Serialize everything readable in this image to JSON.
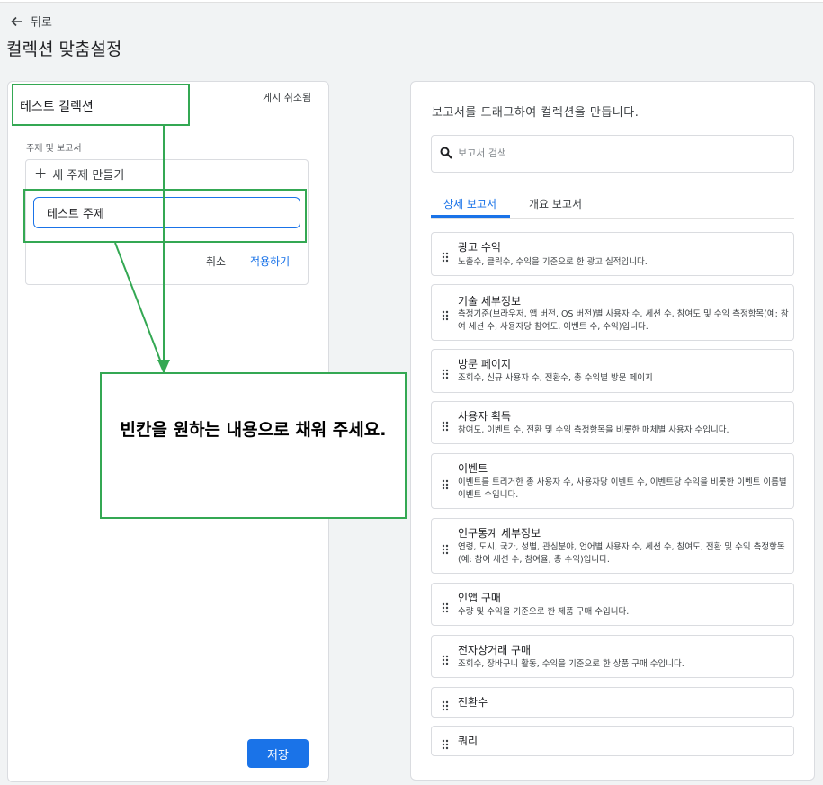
{
  "nav": {
    "back_label": "뒤로"
  },
  "page": {
    "title": "컬렉션 맞춤설정"
  },
  "collection": {
    "name": "테스트 컬렉션",
    "actions_label": "게시 취소됨",
    "section_label": "주제 및 보고서",
    "new_topic_label": "새 주제 만들기",
    "topic_value": "테스트 주제",
    "cancel_label": "취소",
    "apply_label": "적용하기",
    "save_label": "저장"
  },
  "library": {
    "heading": "보고서를 드래그하여 컬렉션을 만듭니다.",
    "search_placeholder": "보고서 검색",
    "tabs": [
      {
        "label": "상세 보고서",
        "active": true
      },
      {
        "label": "개요 보고서",
        "active": false
      }
    ],
    "cards": [
      {
        "title": "광고 수익",
        "desc": "노출수, 클릭수, 수익을 기준으로 한 광고 실적입니다."
      },
      {
        "title": "기술 세부정보",
        "desc": "측정기준(브라우저, 앱 버전, OS 버전)별 사용자 수, 세션 수, 참여도 및 수익 측정항목(예: 참여 세션 수, 사용자당 참여도, 이벤트 수, 수익)입니다."
      },
      {
        "title": "방문 페이지",
        "desc": "조회수, 신규 사용자 수, 전환수, 총 수익별 방문 페이지"
      },
      {
        "title": "사용자 획득",
        "desc": "참여도, 이벤트 수, 전환 및 수익 측정항목을 비롯한 매체별 사용자 수입니다."
      },
      {
        "title": "이벤트",
        "desc": "이벤트를 트리거한 총 사용자 수, 사용자당 이벤트 수, 이벤트당 수익을 비롯한 이벤트 이름별 이벤트 수입니다."
      },
      {
        "title": "인구통계 세부정보",
        "desc": "연령, 도시, 국가, 성별, 관심분야, 언어별 사용자 수, 세션 수, 참여도, 전환 및 수익 측정항목(예: 참여 세션 수, 참여율, 총 수익)입니다."
      },
      {
        "title": "인앱 구매",
        "desc": "수량 및 수익을 기준으로 한 제품 구매 수입니다."
      },
      {
        "title": "전자상거래 구매",
        "desc": "조회수, 장바구니 활동, 수익을 기준으로 한 상품 구매 수입니다."
      },
      {
        "title": "전환수",
        "desc": ""
      },
      {
        "title": "쿼리",
        "desc": ""
      }
    ]
  },
  "annotation": {
    "text": "빈칸을 원하는 내용으로 채워 주세요."
  },
  "colors": {
    "accent": "#1a73e8",
    "annotation": "#34a853"
  }
}
